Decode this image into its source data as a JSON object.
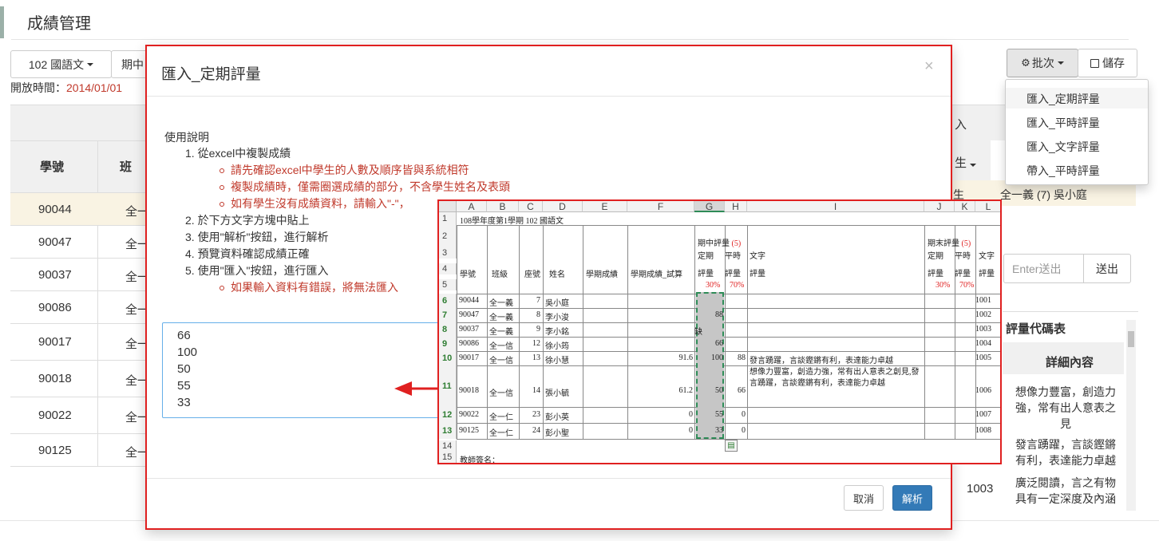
{
  "page_title": "成績管理",
  "toolbar": {
    "subject": "102 國語文",
    "period": "期中",
    "open_time_label": "開放時間：",
    "open_time_value": "2014/01/01",
    "batch_label": "批次",
    "save_label": "儲存"
  },
  "batch_menu": [
    "匯入_定期評量",
    "匯入_平時評量",
    "匯入_文字評量",
    "帶入_平時評量"
  ],
  "bg_table": {
    "col_student_id": "學號",
    "col_class": "班",
    "rows": [
      {
        "id": "90044",
        "cls": "全一"
      },
      {
        "id": "90047",
        "cls": "全一"
      },
      {
        "id": "90037",
        "cls": "全一"
      },
      {
        "id": "90086",
        "cls": "全一"
      },
      {
        "id": "90017",
        "cls": "全一"
      },
      {
        "id": "90018",
        "cls": "全一"
      },
      {
        "id": "90022",
        "cls": "全一"
      },
      {
        "id": "90125",
        "cls": "全一"
      }
    ],
    "right_header_frag": "入",
    "right_sub_header": "生",
    "right_student_frag": "生",
    "right_student": "全一義 (7) 吳小庭",
    "enter_placeholder": "Enter送出",
    "send_label": "送出",
    "code_table_title": "評量代碼表",
    "code_col_detail": "詳細內容",
    "code_row_texts": [
      "想像力豐富，創造力強，常有出人意表之見",
      "發言踴躍，言談鏗鏘有利，表達能力卓越",
      "廣泛閱讀，言之有物具有一定深度及內涵"
    ],
    "code_value": "1003"
  },
  "modal": {
    "title": "匯入_定期評量",
    "close": "×",
    "instructions_title": "使用說明",
    "steps": [
      {
        "text": "1. 從excel中複製成績",
        "subs": [
          "請先確認excel中學生的人數及順序皆與系統相符",
          "複製成績時，僅需圈選成績的部分，不含學生姓名及表頭",
          "如有學生沒有成績資料，請輸入\"-\"，"
        ]
      },
      {
        "text": "2. 於下方文字方塊中貼上",
        "subs": []
      },
      {
        "text": "3. 使用\"解析\"按鈕，進行解析",
        "subs": []
      },
      {
        "text": "4. 預覽資料確認成績正確",
        "subs": []
      },
      {
        "text": "5. 使用\"匯入\"按鈕，進行匯入",
        "subs": [
          "如果輸入資料有錯誤，將無法匯入"
        ]
      }
    ],
    "textarea_value": "66\n100\n50\n55\n33",
    "cancel_label": "取消",
    "parse_label": "解析"
  },
  "excel": {
    "columns": [
      "A",
      "B",
      "C",
      "D",
      "E",
      "F",
      "G",
      "H",
      "I",
      "J",
      "K",
      "L"
    ],
    "title": "108學年度第1學期 102 國語文",
    "mid_header": "期中評量",
    "final_header": "期末評量",
    "weight": "(5)",
    "hdr": {
      "id": "學號",
      "cls": "班級",
      "seat": "座號",
      "name": "姓名",
      "sem": "學期成績",
      "sem_trial": "學期成績_試算",
      "regular1": "定期",
      "regular2": "評量",
      "usual1": "平時",
      "usual2": "評量",
      "text1": "文字",
      "text2": "評量",
      "p30": "30%",
      "p70": "70%"
    },
    "rows": [
      {
        "r": "6",
        "id": "90044",
        "cls": "全一義",
        "seat": "7",
        "name": "吳小庭",
        "f": "",
        "g": "",
        "h": "",
        "i": "",
        "l": "1001"
      },
      {
        "r": "7",
        "id": "90047",
        "cls": "全一義",
        "seat": "8",
        "name": "李小浚",
        "f": "",
        "g": "88",
        "h": "",
        "i": "",
        "l": "1002"
      },
      {
        "r": "8",
        "id": "90037",
        "cls": "全一義",
        "seat": "9",
        "name": "李小銘",
        "f": "",
        "g": "缺",
        "h": "",
        "i": "",
        "l": "1003"
      },
      {
        "r": "9",
        "id": "90086",
        "cls": "全一信",
        "seat": "12",
        "name": "徐小筠",
        "f": "",
        "g": "66",
        "h": "",
        "i": "",
        "l": "1004"
      },
      {
        "r": "10",
        "id": "90017",
        "cls": "全一信",
        "seat": "13",
        "name": "徐小慧",
        "f": "91.6",
        "g": "100",
        "h": "88",
        "i": "發言踴躍，言談鏗鏘有利，表達能力卓越",
        "l": "1005"
      },
      {
        "r": "11",
        "id": "90018",
        "cls": "全一信",
        "seat": "14",
        "name": "張小毓",
        "f": "61.2",
        "g": "50",
        "h": "66",
        "i": "想像力豐富，創造力強，常有出人意表之創見,發言踴躍，言談鏗鏘有利，表達能力卓越",
        "l": "1006"
      },
      {
        "r": "12",
        "id": "90022",
        "cls": "全一仁",
        "seat": "23",
        "name": "彭小英",
        "f": "0",
        "g": "55",
        "h": "0",
        "i": "",
        "l": "1007"
      },
      {
        "r": "13",
        "id": "90125",
        "cls": "全一仁",
        "seat": "24",
        "name": "彭小聖",
        "f": "0",
        "g": "33",
        "h": "0",
        "i": "",
        "l": "1008"
      }
    ],
    "teacher_sign": "教師簽名："
  }
}
